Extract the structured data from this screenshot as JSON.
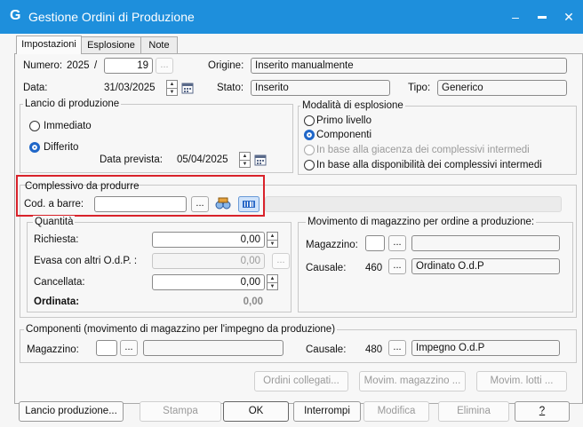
{
  "window": {
    "title": "Gestione Ordini di Produzione",
    "icon_glyph": "G",
    "minimize": "–",
    "maximize": "▬",
    "close": "✕"
  },
  "tabs": [
    "Impostazioni",
    "Esplosione",
    "Note"
  ],
  "header": {
    "numero_label": "Numero:",
    "numero_year": "2025",
    "numero_sep": "/",
    "numero_value": "19",
    "data_label": "Data:",
    "data_value": "31/03/2025",
    "origine_label": "Origine:",
    "origine_value": "Inserito manualmente",
    "stato_label": "Stato:",
    "stato_value": "Inserito",
    "tipo_label": "Tipo:",
    "tipo_value": "Generico"
  },
  "lancio": {
    "title": "Lancio di produzione",
    "opt_immediato": "Immediato",
    "opt_differito": "Differito",
    "selected": "Differito",
    "data_prevista_label": "Data prevista:",
    "data_prevista_value": "05/04/2025"
  },
  "esplosione": {
    "title": "Modalità di esplosione",
    "opt1": "Primo livello",
    "opt2": "Componenti",
    "opt3": "In base alla giacenza dei complessivi intermedi",
    "opt4": "In base alla disponibilità dei complessivi intermedi",
    "selected": "Componenti"
  },
  "complessivo": {
    "title": "Complessivo da produrre",
    "cod_label": "Cod. a barre:",
    "cod_value": "",
    "ellipsis": "..."
  },
  "quantita": {
    "title": "Quantità",
    "richiesta_label": "Richiesta:",
    "richiesta_value": "0,00",
    "evasa_label": "Evasa con altri O.d.P. :",
    "evasa_value": "0,00",
    "cancellata_label": "Cancellata:",
    "cancellata_value": "0,00",
    "ordinata_label": "Ordinata:",
    "ordinata_value": "0,00"
  },
  "movimento": {
    "title": "Movimento di magazzino per ordine a produzione:",
    "magazzino_label": "Magazzino:",
    "magazzino_code": "",
    "magazzino_desc": "",
    "causale_label": "Causale:",
    "causale_code": "460",
    "causale_desc": "Ordinato O.d.P"
  },
  "componenti": {
    "title": "Componenti (movimento di magazzino per l'impegno da produzione)",
    "magazzino_label": "Magazzino:",
    "magazzino_code": "",
    "magazzino_desc": "",
    "causale_label": "Causale:",
    "causale_code": "480",
    "causale_desc": "Impegno O.d.P"
  },
  "actions_row1": [
    "Ordini collegati...",
    "Movim. magazzino ...",
    "Movim. lotti ..."
  ],
  "actions_row2": [
    "Lancio produzione...",
    "Stampa",
    "OK",
    "Interrompi",
    "Modifica",
    "Elimina",
    "?"
  ],
  "colors": {
    "titlebar": "#1e8fdc",
    "highlight": "#d9222a",
    "radio_selected": "#1f66c8"
  }
}
